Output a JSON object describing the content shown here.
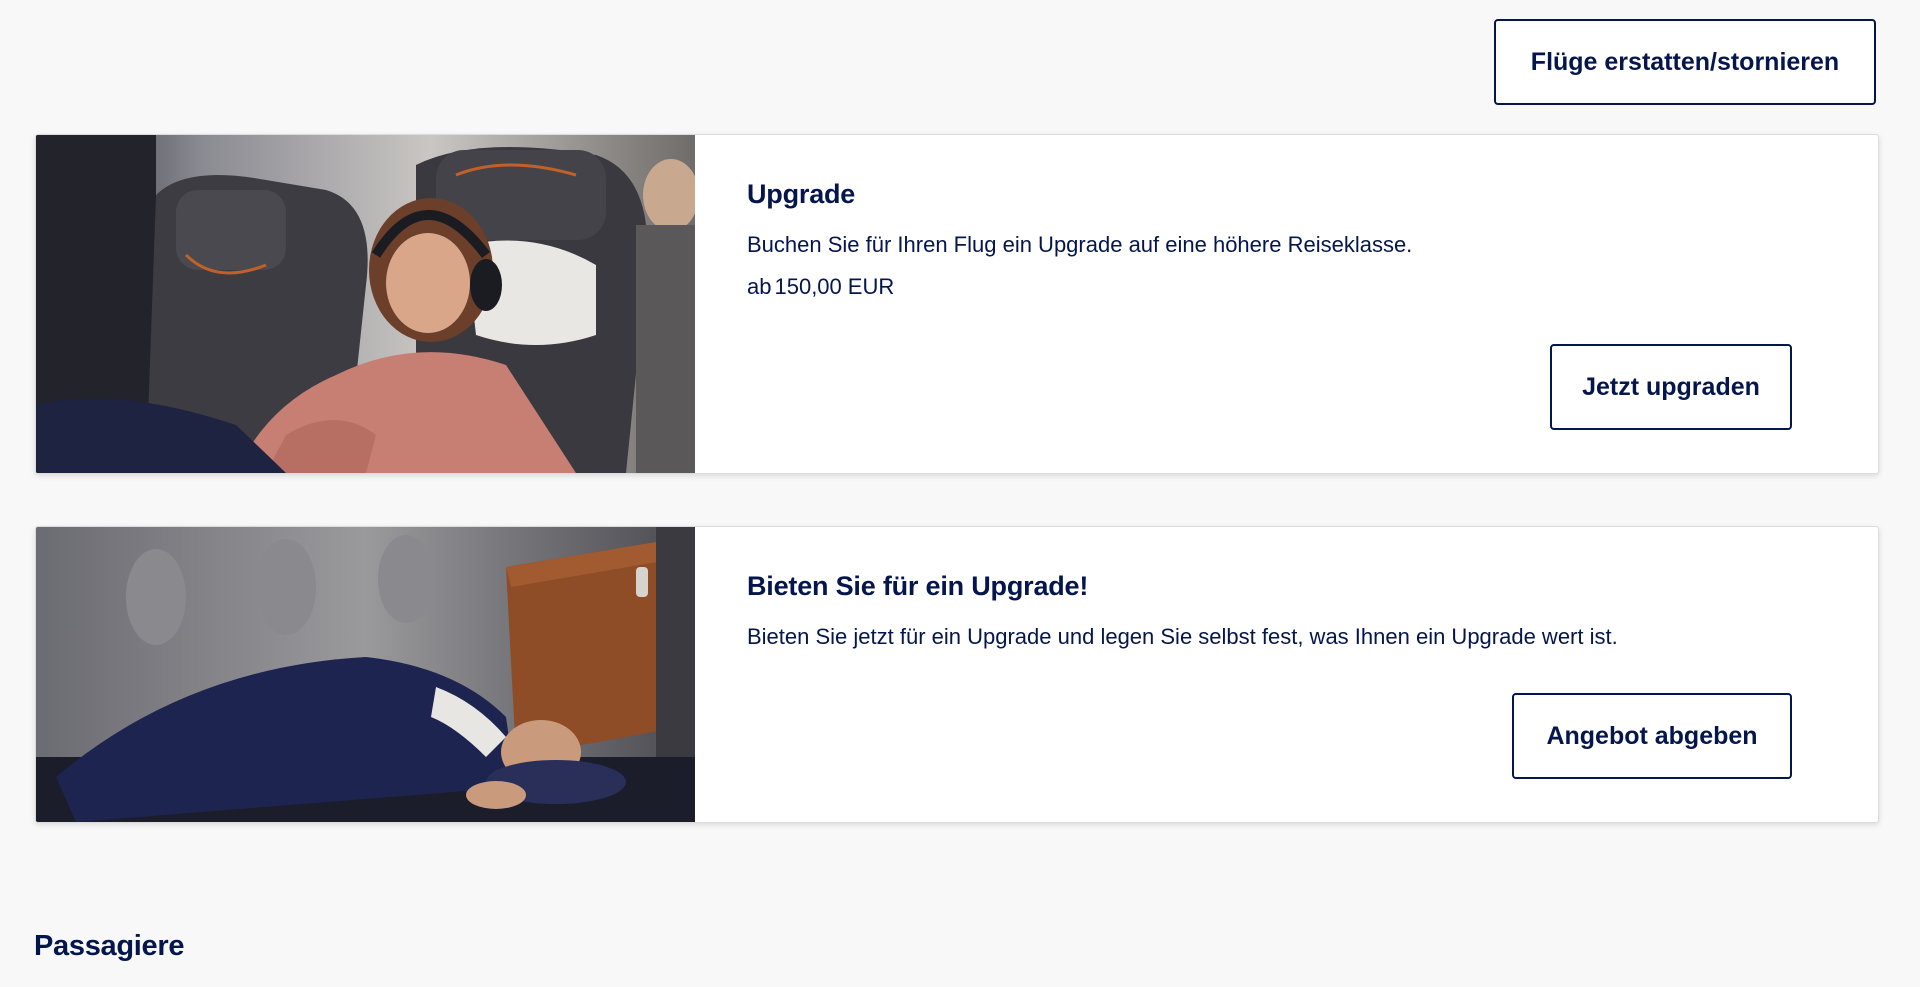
{
  "top_actions": {
    "refund_cancel_label": "Flüge erstatten/stornieren"
  },
  "offers": [
    {
      "title": "Upgrade",
      "description": "Buchen Sie für Ihren Flug ein Upgrade auf eine höhere Reiseklasse.",
      "price_prefix": "ab",
      "price_value": "150,00",
      "price_currency": "EUR",
      "button_label": "Jetzt upgraden",
      "image": "woman-relaxing-in-airplane-seat-photo"
    },
    {
      "title": "Bieten Sie für ein Upgrade!",
      "description": "Bieten Sie jetzt für ein Upgrade und legen Sie selbst fest, was Ihnen ein Upgrade wert ist.",
      "button_label": "Angebot abgeben",
      "image": "man-sleeping-in-business-class-bed-photo"
    }
  ],
  "sections": {
    "passengers_title": "Passagiere"
  },
  "colors": {
    "brand_navy": "#05164d",
    "page_background": "#f8f8f8",
    "card_background": "#ffffff"
  }
}
